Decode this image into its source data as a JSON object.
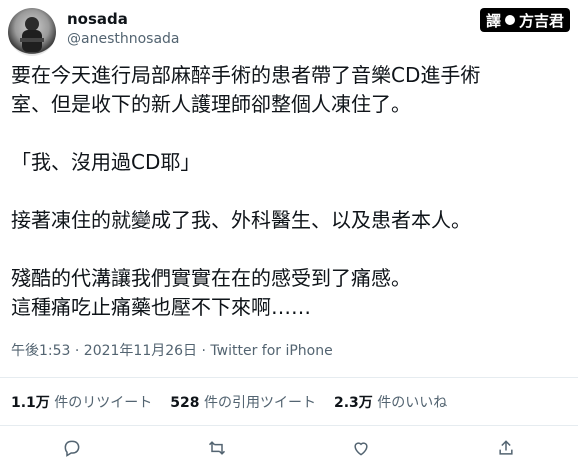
{
  "author": {
    "display_name": "nosada",
    "handle": "@anesthnosada"
  },
  "watermark": {
    "left_text": "譯",
    "right_text": "方吉君"
  },
  "tweet": {
    "text": "要在今天進行局部麻醉手術的患者帶了音樂CD進手術\n室、但是收下的新人護理師卻整個人凍住了。\n\n「我、沒用過CD耶」\n\n接著凍住的就變成了我、外科醫生、以及患者本人。\n\n殘酷的代溝讓我們實實在在的感受到了痛感。\n這種痛吃止痛藥也壓不下來啊……",
    "meta": "午後1:53 · 2021年11月26日 · Twitter for iPhone"
  },
  "stats": {
    "retweets_count": "1.1万",
    "retweets_label": " 件のリツイート",
    "quotes_count": "528",
    "quotes_label": " 件の引用ツイート",
    "likes_count": "2.3万",
    "likes_label": " 件のいいね"
  },
  "icons": [
    "reply-icon",
    "retweet-icon",
    "like-icon",
    "share-icon"
  ],
  "colors": {
    "secondary_text": "#536471",
    "primary_text": "#0f1419",
    "divider": "#e6ecf0"
  }
}
